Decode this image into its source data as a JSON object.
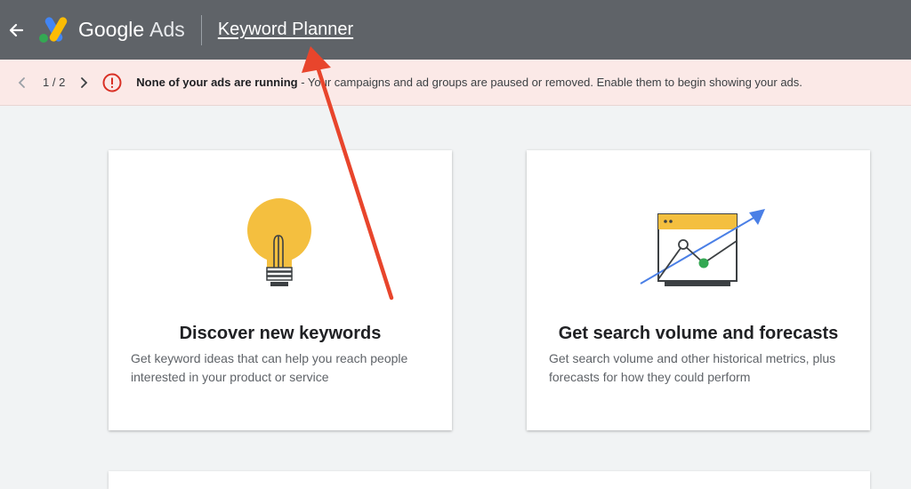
{
  "header": {
    "brand_google": "Google",
    "brand_ads": "Ads",
    "tool_title": "Keyword Planner",
    "icons": {
      "back": "arrow-back-icon",
      "logo": "google-ads-logo"
    }
  },
  "notice": {
    "pager": "1 / 2",
    "headline": "None of your ads are running",
    "detail": " - Your campaigns and ad groups are paused or removed. Enable them to begin showing your ads.",
    "icons": {
      "prev": "chevron-left-icon",
      "next": "chevron-right-icon",
      "alert": "alert-circle-icon"
    }
  },
  "cards": [
    {
      "title": "Discover new keywords",
      "description": "Get keyword ideas that can help you reach people interested in your product or service",
      "icon": "lightbulb-icon"
    },
    {
      "title": "Get search volume and forecasts",
      "description": "Get search volume and other historical metrics, plus forecasts for how they could perform",
      "icon": "chart-forecast-icon"
    }
  ],
  "colors": {
    "topbar": "#5f6368",
    "notice_bg": "#fbe9e7",
    "alert": "#d93025",
    "annotation_arrow": "#e8452c",
    "bulb": "#f4bf3f",
    "trend_blue": "#4a7fe6",
    "point_green": "#34a853"
  }
}
